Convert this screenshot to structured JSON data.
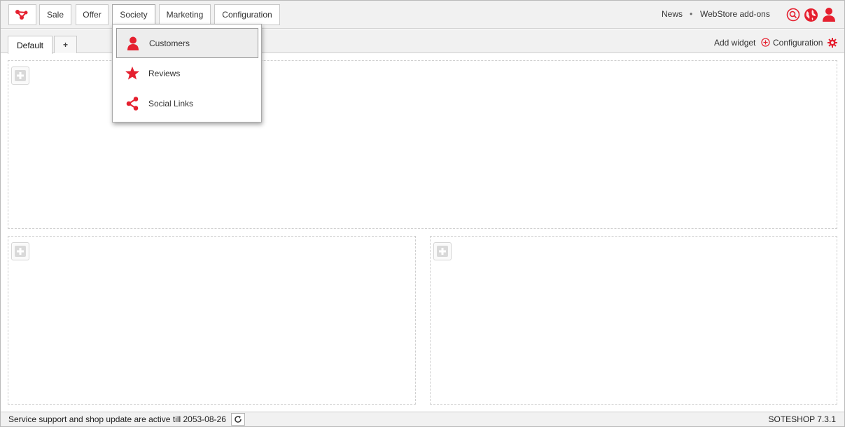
{
  "colors": {
    "accent": "#e5202f",
    "topbar_bg": "#f1f1f1",
    "border": "#c9c9c9"
  },
  "nav": {
    "logo_icon": "network-logo-icon",
    "items": [
      {
        "label": "Sale"
      },
      {
        "label": "Offer"
      },
      {
        "label": "Society"
      },
      {
        "label": "Marketing"
      },
      {
        "label": "Configuration"
      }
    ],
    "active": "Society"
  },
  "header_right": {
    "news_label": "News",
    "separator": "•",
    "webstore_label": "WebStore add-ons",
    "icons": [
      "search-icon",
      "globe-icon",
      "user-icon"
    ]
  },
  "tabs": {
    "items": [
      {
        "label": "Default"
      },
      {
        "label": "+"
      }
    ],
    "add_widget_label": "Add widget",
    "configuration_label": "Configuration"
  },
  "dropdown": {
    "items": [
      {
        "label": "Customers",
        "icon": "user-icon"
      },
      {
        "label": "Reviews",
        "icon": "star-icon"
      },
      {
        "label": "Social Links",
        "icon": "share-icon"
      }
    ]
  },
  "footer": {
    "status_text": "Service support and shop update are active till 2053-08-26",
    "version": "SOTESHOP 7.3.1"
  }
}
